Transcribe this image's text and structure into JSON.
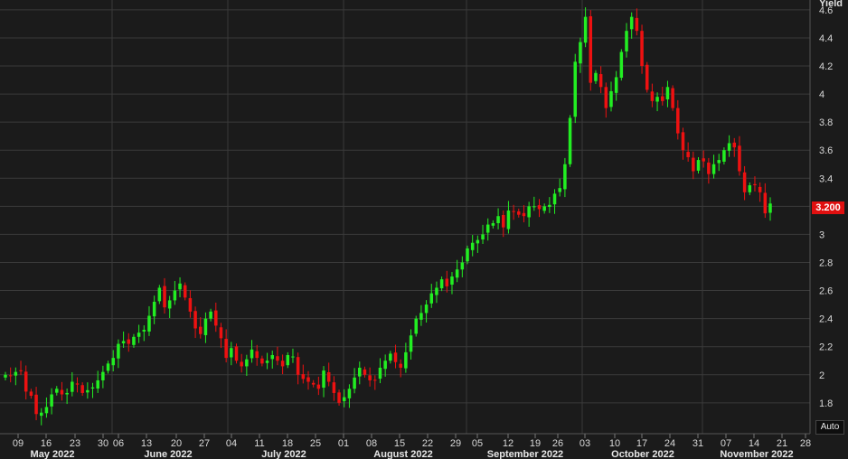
{
  "chart_data": {
    "type": "candlestick",
    "ylabel": "Yield",
    "ylim": [
      1.58,
      4.67
    ],
    "y_ticks": [
      "1.8",
      "2",
      "2.2",
      "2.4",
      "2.6",
      "2.8",
      "3",
      "3.2",
      "3.4",
      "3.6",
      "3.8",
      "4",
      "4.2",
      "4.4",
      "4.6"
    ],
    "x_ticks": [
      "09",
      "16",
      "23",
      "30",
      "06",
      "13",
      "20",
      "27",
      "04",
      "11",
      "18",
      "25",
      "01",
      "08",
      "15",
      "22",
      "29",
      "05",
      "12",
      "19",
      "26",
      "03",
      "10",
      "17",
      "24",
      "31",
      "07",
      "14",
      "21",
      "28"
    ],
    "months": [
      "May 2022",
      "June 2022",
      "July 2022",
      "August 2022",
      "September 2022",
      "October 2022",
      "November 2022"
    ],
    "last_value": "3.200",
    "auto_label": "Auto",
    "colors": {
      "up": "#22ee22",
      "down": "#ee1111",
      "background": "#1b1b1b",
      "grid": "#3a3a3a",
      "badge": "#e01010"
    },
    "closes": [
      2.0,
      1.99,
      2.02,
      2.03,
      1.88,
      1.85,
      1.72,
      1.73,
      1.77,
      1.86,
      1.9,
      1.86,
      1.87,
      1.95,
      1.93,
      1.87,
      1.89,
      1.91,
      1.96,
      2.02,
      2.08,
      2.12,
      2.22,
      2.24,
      2.22,
      2.27,
      2.3,
      2.32,
      2.42,
      2.52,
      2.62,
      2.48,
      2.53,
      2.6,
      2.65,
      2.55,
      2.45,
      2.33,
      2.29,
      2.4,
      2.45,
      2.35,
      2.26,
      2.12,
      2.19,
      2.1,
      2.06,
      2.11,
      2.18,
      2.12,
      2.08,
      2.1,
      2.14,
      2.1,
      2.06,
      2.14,
      2.13,
      2.0,
      1.97,
      1.95,
      1.93,
      1.9,
      2.03,
      1.95,
      1.87,
      1.8,
      1.84,
      1.9,
      1.98,
      2.05,
      2.0,
      1.96,
      1.96,
      2.05,
      2.1,
      2.15,
      2.09,
      2.05,
      2.16,
      2.28,
      2.4,
      2.44,
      2.5,
      2.58,
      2.62,
      2.68,
      2.63,
      2.7,
      2.75,
      2.8,
      2.9,
      2.94,
      2.96,
      3.0,
      3.07,
      3.08,
      3.13,
      3.05,
      3.17,
      3.16,
      3.14,
      3.13,
      3.2,
      3.2,
      3.18,
      3.2,
      3.21,
      3.29,
      3.33,
      3.5,
      3.83,
      4.23,
      4.37,
      4.55,
      4.08,
      4.15,
      4.05,
      3.9,
      4.02,
      4.12,
      4.3,
      4.45,
      4.55,
      4.45,
      4.2,
      4.03,
      3.95,
      3.98,
      3.95,
      4.05,
      3.9,
      3.72,
      3.6,
      3.55,
      3.45,
      3.53,
      3.52,
      3.43,
      3.5,
      3.53,
      3.6,
      3.65,
      3.62,
      3.45,
      3.3,
      3.35,
      3.35,
      3.3,
      3.15,
      3.22
    ]
  }
}
